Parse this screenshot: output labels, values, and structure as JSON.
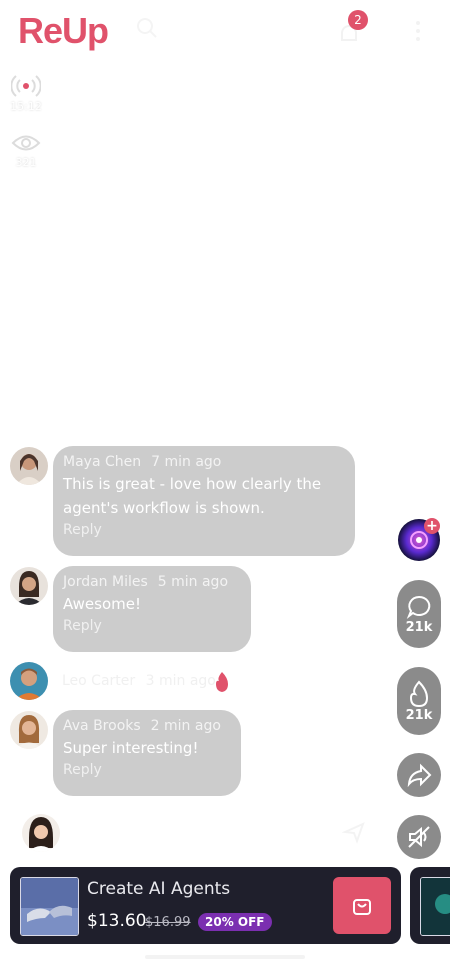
{
  "header": {
    "logo": "ReUp",
    "notification_count": "2"
  },
  "stats": {
    "live_time": "15:12",
    "views": "321"
  },
  "comments": [
    {
      "name": "Maya Chen",
      "time": "7 min ago",
      "text": "This is great - love how clearly the agent's workflow is shown.",
      "reply": "Reply"
    },
    {
      "name": "Jordan Miles",
      "time": "5 min ago",
      "text": "Awesome!",
      "reply": "Reply"
    },
    {
      "name": "Leo Carter",
      "time": "3 min ago",
      "text": ""
    },
    {
      "name": "Ava Brooks",
      "time": "2 min ago",
      "text": "Super interesting!",
      "reply": "Reply"
    }
  ],
  "actions": {
    "comments_count": "21k",
    "likes_count": "21k"
  },
  "product": {
    "name": "Create AI Agents",
    "price": "$13.60",
    "old_price": "$16.99",
    "discount": "20% OFF"
  },
  "colors": {
    "brand": "#e0526b",
    "discount_badge": "#7b2fb0",
    "card_bg": "#1f1f2c"
  }
}
